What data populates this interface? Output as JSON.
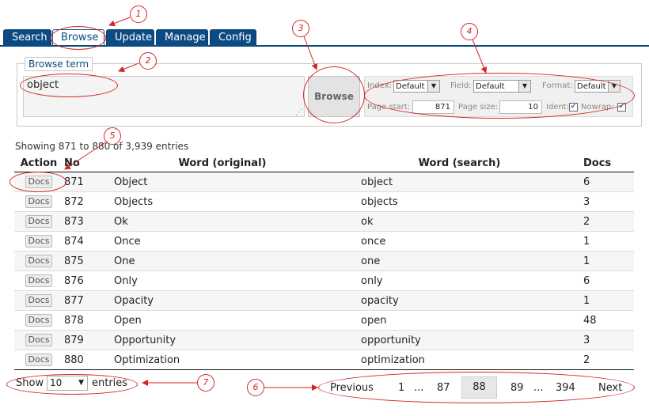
{
  "tabs": [
    {
      "label": "Search",
      "active": false
    },
    {
      "label": "Browse",
      "active": true
    },
    {
      "label": "Update",
      "active": false
    },
    {
      "label": "Manage",
      "active": false
    },
    {
      "label": "Config",
      "active": false
    }
  ],
  "browse_term": {
    "legend": "Browse term",
    "value": "object",
    "button_label": "Browse"
  },
  "options": {
    "index_label": "Index:",
    "index_value": "Default",
    "field_label": "Field:",
    "field_value": "Default",
    "format_label": "Format:",
    "format_value": "Default",
    "page_start_label": "Page start:",
    "page_start_value": "871",
    "page_size_label": "Page size:",
    "page_size_value": "10",
    "ident_label": "Ident:",
    "ident_checked": true,
    "nowrap_label": "Nowrap:",
    "nowrap_checked": true
  },
  "info_text": "Showing 871 to 880 of 3,939 entries",
  "table": {
    "columns": [
      "Action",
      "No",
      "Word (original)",
      "Word (search)",
      "Docs"
    ],
    "action_label": "Docs",
    "rows": [
      {
        "no": "871",
        "original": "Object",
        "search": "object",
        "docs": "6"
      },
      {
        "no": "872",
        "original": "Objects",
        "search": "objects",
        "docs": "3"
      },
      {
        "no": "873",
        "original": "Ok",
        "search": "ok",
        "docs": "2"
      },
      {
        "no": "874",
        "original": "Once",
        "search": "once",
        "docs": "1"
      },
      {
        "no": "875",
        "original": "One",
        "search": "one",
        "docs": "1"
      },
      {
        "no": "876",
        "original": "Only",
        "search": "only",
        "docs": "6"
      },
      {
        "no": "877",
        "original": "Opacity",
        "search": "opacity",
        "docs": "1"
      },
      {
        "no": "878",
        "original": "Open",
        "search": "open",
        "docs": "48"
      },
      {
        "no": "879",
        "original": "Opportunity",
        "search": "opportunity",
        "docs": "3"
      },
      {
        "no": "880",
        "original": "Optimization",
        "search": "optimization",
        "docs": "2"
      }
    ]
  },
  "footer": {
    "show_label": "Show",
    "entries_value": "10",
    "entries_label": "entries"
  },
  "pagination": {
    "previous": "Previous",
    "first": "1",
    "ellipsis": "...",
    "prev_page": "87",
    "current": "88",
    "next_page": "89",
    "last": "394",
    "next": "Next"
  },
  "callouts": [
    "1",
    "2",
    "3",
    "4",
    "5",
    "6",
    "7"
  ],
  "colors": {
    "tab_blue": "#0b4a82",
    "annotation_red": "#d42626"
  }
}
